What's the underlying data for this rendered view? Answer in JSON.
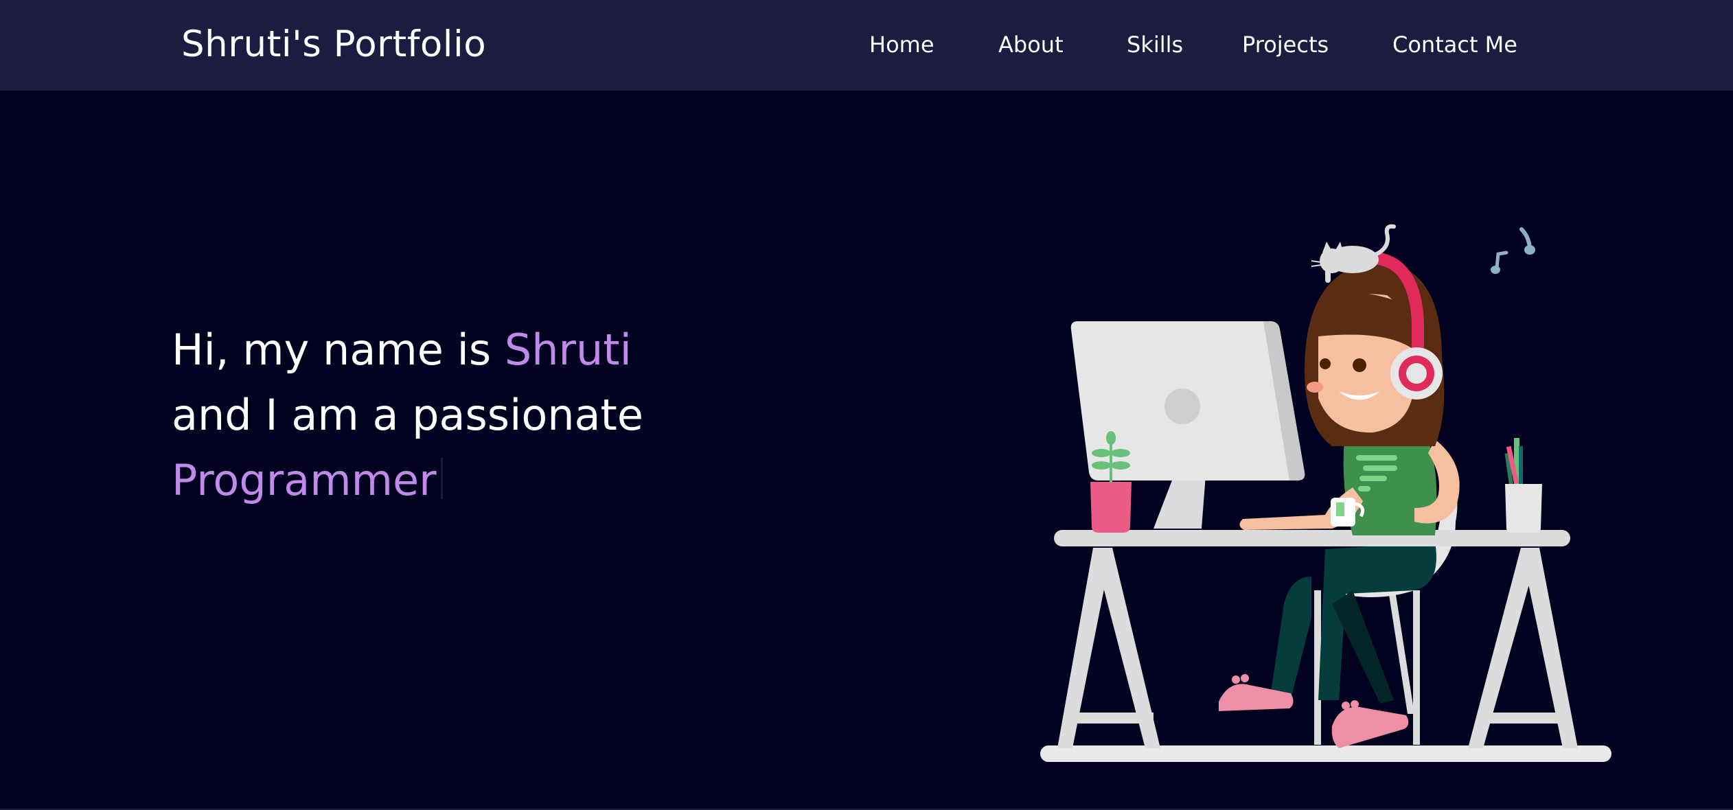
{
  "header": {
    "brand": "Shruti's Portfolio",
    "nav": [
      {
        "label": "Home"
      },
      {
        "label": "About"
      },
      {
        "label": "Skills"
      },
      {
        "label": "Projects"
      },
      {
        "label": "Contact Me"
      }
    ]
  },
  "hero": {
    "line1_prefix": "Hi, my name is ",
    "name": "Shruti",
    "line2": "and I am a passionate",
    "role": "Programmer"
  },
  "colors": {
    "navbar_bg": "#1c1c40",
    "page_bg": "#00001f",
    "accent": "#c089ea",
    "text": "#ffffff"
  },
  "icons": {
    "illustration": "girl-at-desk-with-computer-illustration"
  }
}
